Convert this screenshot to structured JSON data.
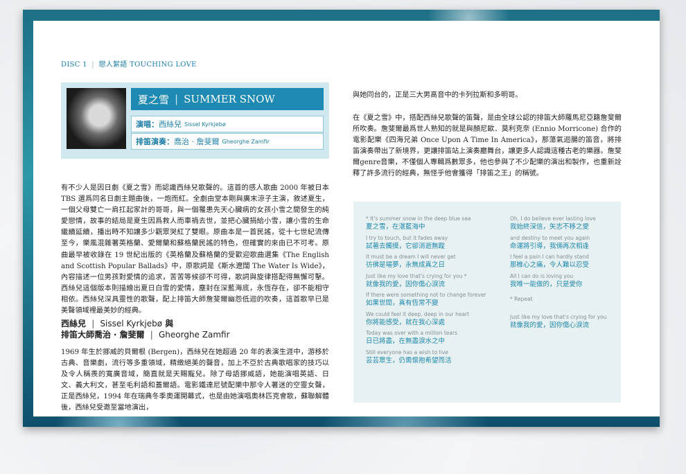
{
  "header": {
    "disc": "DISC 1",
    "sep": "|",
    "title": "戀人絮語 TOUCHING LOVE"
  },
  "song": {
    "title_zh": "夏之雪",
    "bar": "|",
    "title_en": "SUMMER SNOW",
    "singer_label": "演唱：",
    "singer_zh": "西絲兒",
    "singer_en": "Sissel Kyrkjebø",
    "flute_label": "排笛演奏：",
    "flute_zh": "喬治 ‧ 詹斐爾",
    "flute_en": "Gheorghe Zamfir"
  },
  "left_paragraph1": "有不少人是因日劇《夏之雪》而認識西絲兒歌聲的。這首的感人歌曲 2000 年被日本 TBS 選爲同名日劇主題曲後，一炮而紅。全劇由堂本剛與廣末涼子主演，敘述夏生，一個父母雙亡一肩扛起家計的哥哥，與一個罹患先天心臟病的女孩小雪之間發生的純愛戀情，故事的結局是夏生因爲救人而車禍去世，並把心臟捐給小雪，讓小雪的生命繼續延續，播出時不知讓多少觀眾哭紅了雙眼。原曲本是一首民謠，從十七世紀流傳至今，樂風混雜著英格蘭、愛爾蘭和蘇格蘭民謠的特色，但確實的來由已不可考。原曲最早被收錄在 19 世紀出版的《英格蘭及蘇格蘭的受歡迎歌曲選集《The English and Scottish Popular Ballads》中，原歌詞是《斯水遼闊 The Water Is Wide》，內容描述一位男孩對愛情的追求，苦苦等候卻不可得，歌詞與旋律搭配得無懈可擊。西絲兒這個版本則描繪出夏日白雪的愛情，塵封在深藍海底，永恆存在，卻不能相守相依。西絲兒深具靈性的歌聲，配上排笛大師詹斐爾幽怨低迴的吹奏，這首歌早已是美聲領域裡最美妙的經典。",
  "subhead": {
    "line1_zh": "西絲兒",
    "line1_en": "Sissel Kyrkjebø",
    "line1_and": "與",
    "line2_zh": "排笛大師喬治 ‧ 詹斐爾",
    "line2_en": "Gheorghe Zamfir",
    "pipe": "|"
  },
  "left_paragraph2": "1969 年生於挪威的貝爾根 (Bergen)，西絲兒在她超過 20 年的表演生涯中，游移於古典、音樂劇，流行等多重領域，精緻絕美的聲音，加上不亞於古典歌唱家的技巧以及令人稱羨的寬廣音域，簡直就是天賜寵兒。除了母語挪威語，她能演唱英語、日文、義大利文，甚至毛利語和蓋爾語。電影鐵達尼號配樂中那令人著迷的空靈女聲，正是西絲兒，1994 年在瑞典冬季奧運開幕式，也是由她演唱奧林匹克會歌，蘇聯解體後，西絲兒受邀至當地演出，",
  "right_paragraph1": "與她同台的，正是三大男高音中的卡列拉斯和多明哥。",
  "right_paragraph2": "在《夏之雪》中，搭配西絲兒歌聲的笛聲，是由全球公認的排笛大師羅馬尼亞籍詹斐爾所吹奏。詹斐爾最爲世人熟知的就是與顏尼歐．莫利克奈 (Ennio Morricone) 合作的電影配樂《四海兄弟 Once Upon A Time In America》，那蕩氣迴腸的笛音，將排笛演奏帶出了新境界，更讓排笛站上演奏廳舞台，讓更多人認識這種古老的樂器。詹斐爾genre音樂，不僅個人專輯爲數眾多，他也參與了不少配樂的演出和製作，也重新詮釋了許多流行的經典，無怪乎他會獲得「排笛之王」的稱號。",
  "lyrics": {
    "left": [
      {
        "en": "* It's summer snow in the deep blue sea",
        "zh": "夏之雪，在湛藍海中"
      },
      {
        "en": "I try to touch, but it fades away",
        "zh": "試著去觸摸，它卻消逝無蹤"
      },
      {
        "en": "It must be a dream I will never get",
        "zh": "彷彿是場夢，永無成真之日"
      },
      {
        "en": "Just like my love that's crying for you *",
        "zh": "就像我的愛，因你傷心淚流"
      },
      {
        "en": "If there were something not to change forever",
        "zh": "如果世間，真有恆常不變"
      },
      {
        "en": "We could feel it deep, deep in our heart",
        "zh": "你將能感受，就在我心深處"
      },
      {
        "en": "Today was over with a million tears",
        "zh": "日已將盡，在無盡淚水之中"
      },
      {
        "en": "Still everyone has a wish to live",
        "zh": "芸芸眾生，仍需懷抱希望而活"
      }
    ],
    "right": [
      {
        "en": "Oh, I do believe ever lasting love",
        "zh": "我始終深信，矢志不移之愛"
      },
      {
        "en": "and destiny to meet you again",
        "zh": "命運將引導，我倆再次相逢"
      },
      {
        "en": "I feel a pain I can hardly stand",
        "zh": "那椎心之痛，令人難以忍受"
      },
      {
        "en": "All I can do is loving you",
        "zh": "我唯一能做的，只是愛你"
      }
    ],
    "repeat": "* Repeat",
    "after_repeat": {
      "en": "Just like my love that's crying for you",
      "zh": "就像我的愛，因你傷心淚流"
    }
  }
}
